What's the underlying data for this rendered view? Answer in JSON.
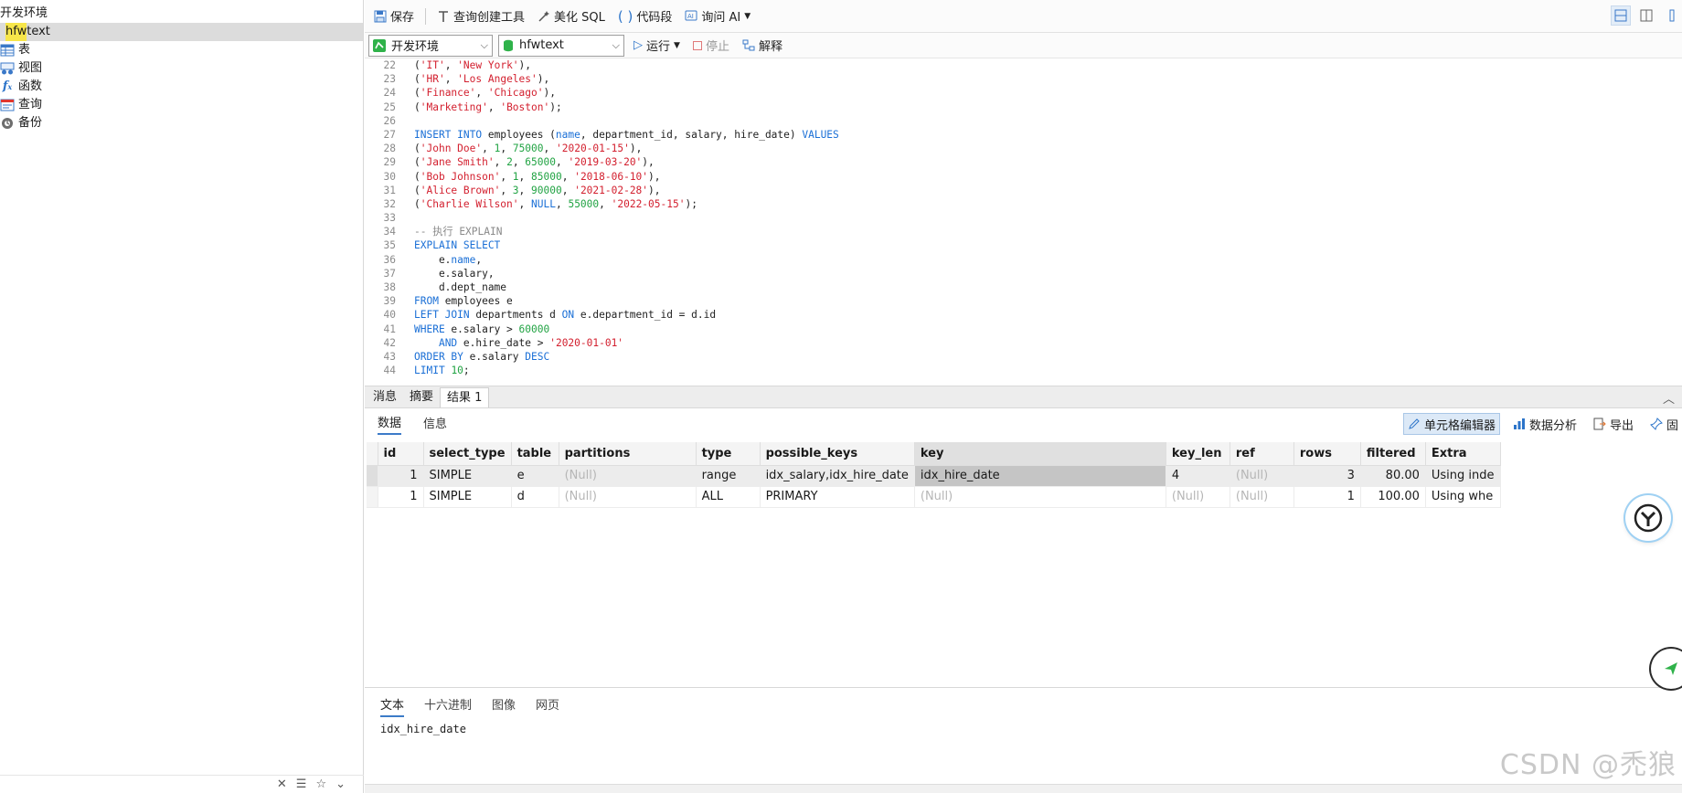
{
  "tree": {
    "root_label": "开发环境",
    "db_label_highlight": "hfw",
    "db_label_rest": "text",
    "children": [
      {
        "label": "表"
      },
      {
        "label": "视图"
      },
      {
        "label": "函数"
      },
      {
        "label": "查询"
      },
      {
        "label": "备份"
      }
    ]
  },
  "toolbar": {
    "save": "保存",
    "query_builder": "查询创建工具",
    "beautify": "美化 SQL",
    "snippet": "代码段",
    "ask_ai": "询问 AI",
    "connection": "开发环境",
    "database": "hfwtext",
    "run": "运行",
    "stop": "停止",
    "explain": "解释"
  },
  "editor": {
    "lines": [
      {
        "n": "22",
        "tokens": [
          [
            "tx",
            "("
          ],
          [
            "str",
            "'IT'"
          ],
          [
            "tx",
            ", "
          ],
          [
            "str",
            "'New York'"
          ],
          [
            "tx",
            "),"
          ]
        ]
      },
      {
        "n": "23",
        "tokens": [
          [
            "tx",
            "("
          ],
          [
            "str",
            "'HR'"
          ],
          [
            "tx",
            ", "
          ],
          [
            "str",
            "'Los Angeles'"
          ],
          [
            "tx",
            "),"
          ]
        ]
      },
      {
        "n": "24",
        "tokens": [
          [
            "tx",
            "("
          ],
          [
            "str",
            "'Finance'"
          ],
          [
            "tx",
            ", "
          ],
          [
            "str",
            "'Chicago'"
          ],
          [
            "tx",
            "),"
          ]
        ]
      },
      {
        "n": "25",
        "tokens": [
          [
            "tx",
            "("
          ],
          [
            "str",
            "'Marketing'"
          ],
          [
            "tx",
            ", "
          ],
          [
            "str",
            "'Boston'"
          ],
          [
            "tx",
            ");"
          ]
        ]
      },
      {
        "n": "26",
        "tokens": []
      },
      {
        "n": "27",
        "tokens": [
          [
            "kw",
            "INSERT INTO"
          ],
          [
            "tx",
            " employees ("
          ],
          [
            "kw",
            "name"
          ],
          [
            "tx",
            ", department_id, salary, hire_date) "
          ],
          [
            "kw",
            "VALUES"
          ]
        ]
      },
      {
        "n": "28",
        "tokens": [
          [
            "tx",
            "("
          ],
          [
            "str",
            "'John Doe'"
          ],
          [
            "tx",
            ", "
          ],
          [
            "num",
            "1"
          ],
          [
            "tx",
            ", "
          ],
          [
            "num",
            "75000"
          ],
          [
            "tx",
            ", "
          ],
          [
            "str",
            "'2020-01-15'"
          ],
          [
            "tx",
            "),"
          ]
        ]
      },
      {
        "n": "29",
        "tokens": [
          [
            "tx",
            "("
          ],
          [
            "str",
            "'Jane Smith'"
          ],
          [
            "tx",
            ", "
          ],
          [
            "num",
            "2"
          ],
          [
            "tx",
            ", "
          ],
          [
            "num",
            "65000"
          ],
          [
            "tx",
            ", "
          ],
          [
            "str",
            "'2019-03-20'"
          ],
          [
            "tx",
            "),"
          ]
        ]
      },
      {
        "n": "30",
        "tokens": [
          [
            "tx",
            "("
          ],
          [
            "str",
            "'Bob Johnson'"
          ],
          [
            "tx",
            ", "
          ],
          [
            "num",
            "1"
          ],
          [
            "tx",
            ", "
          ],
          [
            "num",
            "85000"
          ],
          [
            "tx",
            ", "
          ],
          [
            "str",
            "'2018-06-10'"
          ],
          [
            "tx",
            "),"
          ]
        ]
      },
      {
        "n": "31",
        "tokens": [
          [
            "tx",
            "("
          ],
          [
            "str",
            "'Alice Brown'"
          ],
          [
            "tx",
            ", "
          ],
          [
            "num",
            "3"
          ],
          [
            "tx",
            ", "
          ],
          [
            "num",
            "90000"
          ],
          [
            "tx",
            ", "
          ],
          [
            "str",
            "'2021-02-28'"
          ],
          [
            "tx",
            "),"
          ]
        ]
      },
      {
        "n": "32",
        "tokens": [
          [
            "tx",
            "("
          ],
          [
            "str",
            "'Charlie Wilson'"
          ],
          [
            "tx",
            ", "
          ],
          [
            "kw",
            "NULL"
          ],
          [
            "tx",
            ", "
          ],
          [
            "num",
            "55000"
          ],
          [
            "tx",
            ", "
          ],
          [
            "str",
            "'2022-05-15'"
          ],
          [
            "tx",
            ");"
          ]
        ]
      },
      {
        "n": "33",
        "tokens": []
      },
      {
        "n": "34",
        "tokens": [
          [
            "cm",
            "-- 执行 EXPLAIN"
          ]
        ]
      },
      {
        "n": "35",
        "tokens": [
          [
            "kw",
            "EXPLAIN SELECT"
          ]
        ]
      },
      {
        "n": "36",
        "tokens": [
          [
            "tx",
            "    e."
          ],
          [
            "kw",
            "name"
          ],
          [
            "tx",
            ","
          ]
        ]
      },
      {
        "n": "37",
        "tokens": [
          [
            "tx",
            "    e.salary,"
          ]
        ]
      },
      {
        "n": "38",
        "tokens": [
          [
            "tx",
            "    d.dept_name"
          ]
        ]
      },
      {
        "n": "39",
        "tokens": [
          [
            "kw",
            "FROM"
          ],
          [
            "tx",
            " employees e"
          ]
        ]
      },
      {
        "n": "40",
        "tokens": [
          [
            "kw",
            "LEFT JOIN"
          ],
          [
            "tx",
            " departments d "
          ],
          [
            "kw",
            "ON"
          ],
          [
            "tx",
            " e.department_id = d.id"
          ]
        ]
      },
      {
        "n": "41",
        "tokens": [
          [
            "kw",
            "WHERE"
          ],
          [
            "tx",
            " e.salary > "
          ],
          [
            "num",
            "60000"
          ]
        ]
      },
      {
        "n": "42",
        "tokens": [
          [
            "tx",
            "    "
          ],
          [
            "kw",
            "AND"
          ],
          [
            "tx",
            " e.hire_date > "
          ],
          [
            "str",
            "'2020-01-01'"
          ]
        ]
      },
      {
        "n": "43",
        "tokens": [
          [
            "kw",
            "ORDER BY"
          ],
          [
            "tx",
            " e.salary "
          ],
          [
            "kw",
            "DESC"
          ]
        ]
      },
      {
        "n": "44",
        "tokens": [
          [
            "kw",
            "LIMIT"
          ],
          [
            "tx",
            " "
          ],
          [
            "num",
            "10"
          ],
          [
            "tx",
            ";"
          ]
        ]
      }
    ]
  },
  "result_tabs": [
    "消息",
    "摘要",
    "结果 1"
  ],
  "sub_tabs": [
    "数据",
    "信息"
  ],
  "grid_tools": {
    "cell_editor": "单元格编辑器",
    "data_analysis": "数据分析",
    "export": "导出",
    "pin": "固"
  },
  "grid": {
    "columns": [
      "id",
      "select_type",
      "table",
      "partitions",
      "type",
      "possible_keys",
      "key",
      "key_len",
      "ref",
      "rows",
      "filtered",
      "Extra"
    ],
    "rows": [
      [
        "1",
        "SIMPLE",
        "e",
        "(Null)",
        "range",
        "idx_salary,idx_hire_date",
        "idx_hire_date",
        "4",
        "(Null)",
        "3",
        "80.00",
        "Using inde"
      ],
      [
        "1",
        "SIMPLE",
        "d",
        "(Null)",
        "ALL",
        "PRIMARY",
        "(Null)",
        "(Null)",
        "(Null)",
        "1",
        "100.00",
        "Using whe"
      ]
    ]
  },
  "bottom_tabs": [
    "文本",
    "十六进制",
    "图像",
    "网页"
  ],
  "bottom_value": "idx_hire_date",
  "watermark": "CSDN @禿狼",
  "colors": {
    "keyword": "#1a6fd6",
    "string": "#d3202f",
    "number": "#21a343",
    "accent": "#3c7bc8"
  }
}
